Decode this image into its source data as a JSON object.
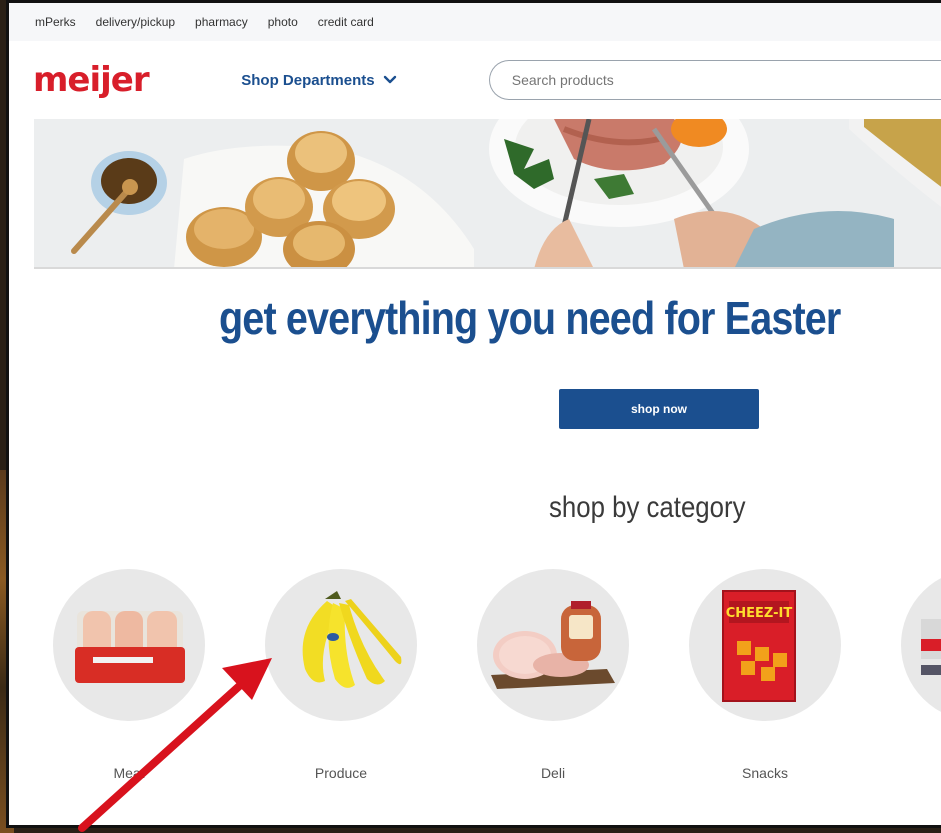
{
  "utility_nav": {
    "items": [
      "mPerks",
      "delivery/pickup",
      "pharmacy",
      "photo",
      "credit card"
    ]
  },
  "header": {
    "logo": "meijer",
    "shop_departments": "Shop Departments",
    "search_placeholder": "Search products"
  },
  "hero": {
    "headline": "get everything you need for Easter",
    "cta": "shop now"
  },
  "categories": {
    "title": "shop by category",
    "items": [
      "Meat",
      "Produce",
      "Deli",
      "Snacks"
    ]
  },
  "colors": {
    "brand_red": "#d81e2a",
    "brand_blue": "#1b4f8f",
    "annotation_arrow": "#d8121d"
  }
}
